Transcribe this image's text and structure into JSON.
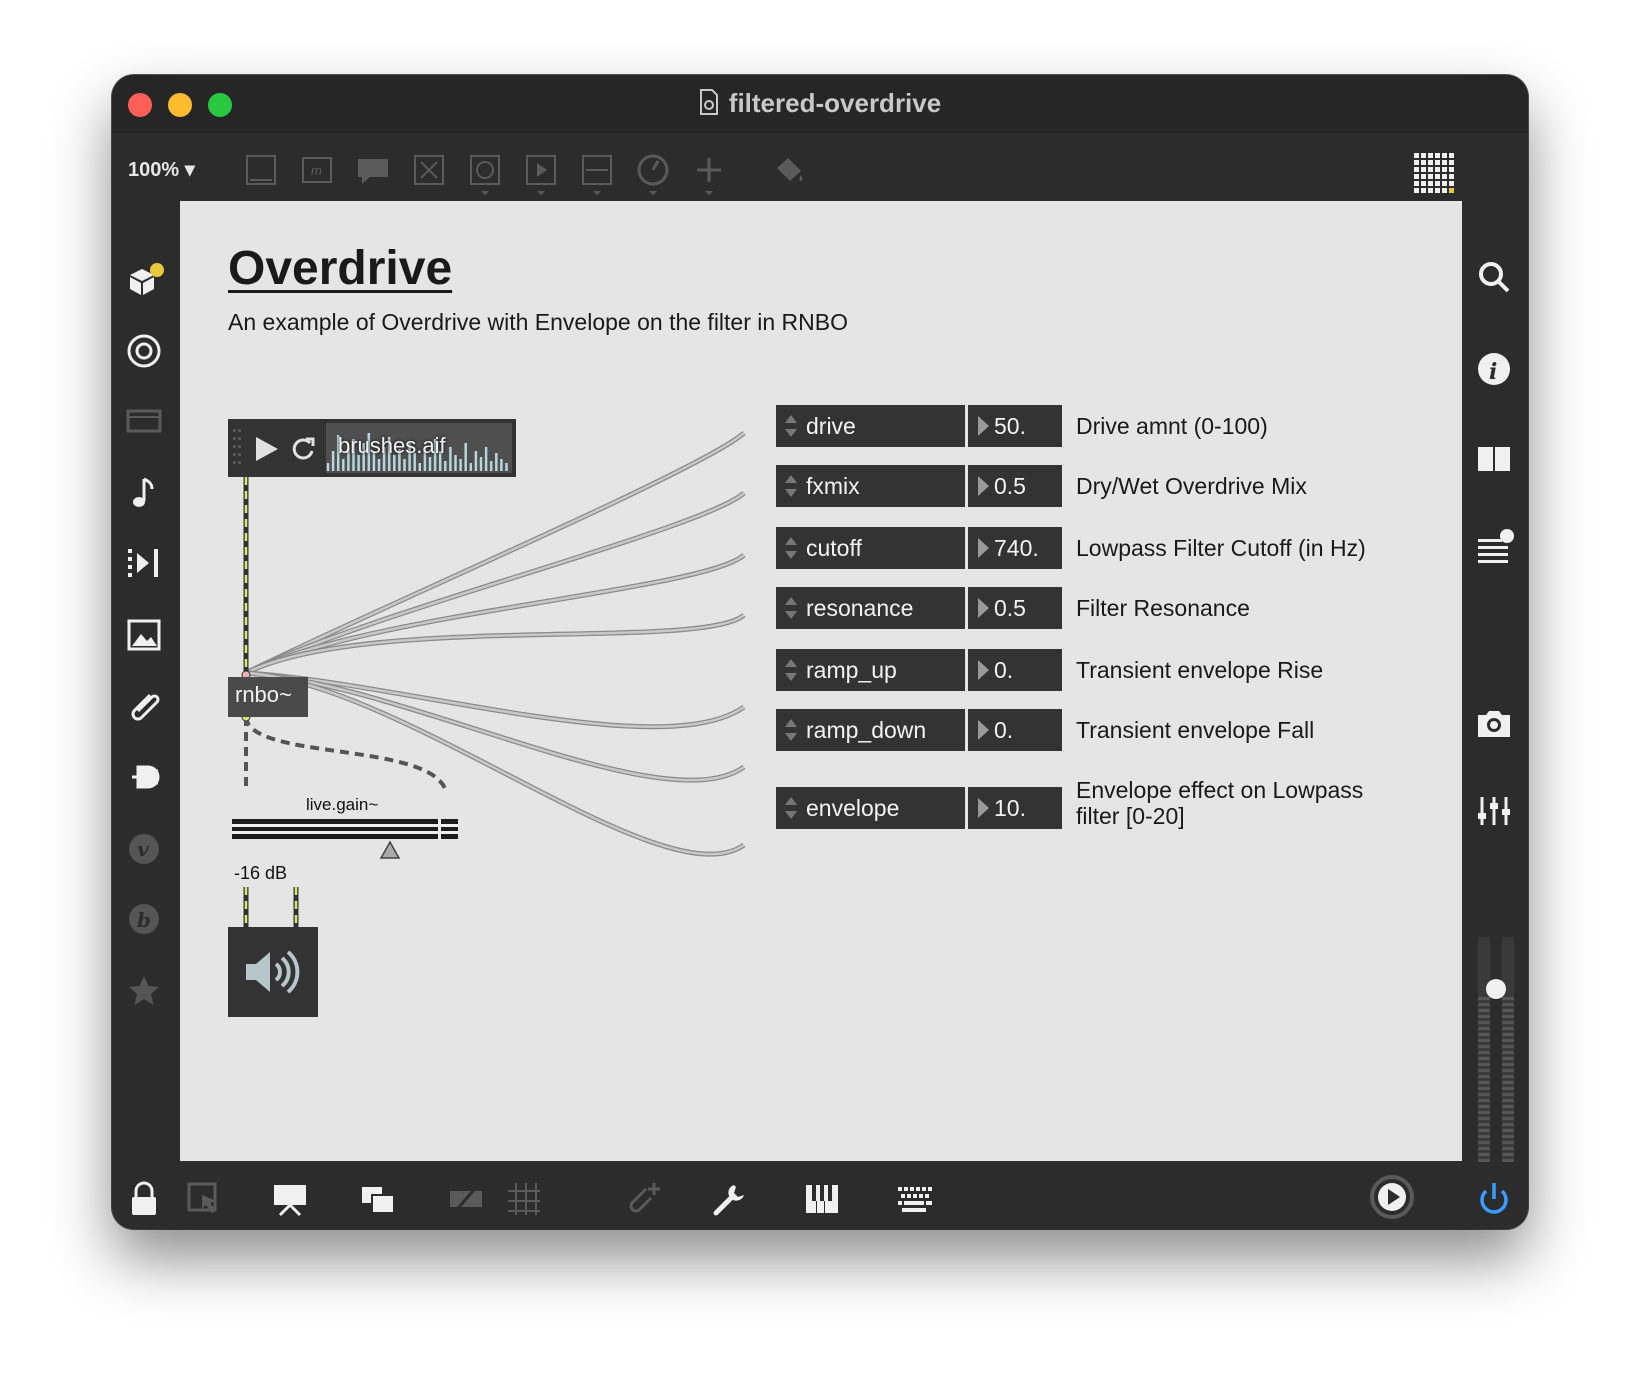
{
  "window": {
    "title": "filtered-overdrive",
    "zoom": "100%",
    "zoom_caret": "▾"
  },
  "toolbar_icons": [
    "new-object-icon",
    "message-icon",
    "comment-icon",
    "toggle-icon",
    "button-icon",
    "play-icon",
    "slider-icon",
    "dial-icon",
    "plus-icon",
    "paint-bucket-icon",
    "grid-palette-icon"
  ],
  "left_sidebar": [
    "packages-icon",
    "target-icon",
    "video-icon",
    "music-note-icon",
    "step-icon",
    "image-icon",
    "paperclip-icon",
    "plug-icon",
    "v-icon",
    "b-icon",
    "star-icon"
  ],
  "right_sidebar": [
    "search-icon",
    "info-icon",
    "split-view-icon",
    "list-icon",
    "camera-icon",
    "mixer-icon"
  ],
  "bottom_bar": [
    "lock-icon",
    "select-icon",
    "presentation-icon",
    "windows-icon",
    "hide-icon",
    "grid-icon",
    "clip-add-icon",
    "wrench-icon",
    "piano-icon",
    "keyboard-icon",
    "play-circle-icon",
    "power-icon"
  ],
  "patch": {
    "heading": "Overdrive",
    "subtitle": "An example of Overdrive with Envelope on the filter in RNBO",
    "player": {
      "file": "brushes.aif"
    },
    "rnbo": "rnbo~",
    "gain": {
      "label": "live.gain~",
      "value": "-16 dB",
      "level": 0.7
    },
    "params": [
      {
        "name": "drive",
        "value": "50.",
        "desc": "Drive amnt (0-100)"
      },
      {
        "name": "fxmix",
        "value": "0.5",
        "desc": "Dry/Wet Overdrive Mix"
      },
      {
        "name": "cutoff",
        "value": "740.",
        "desc": "Lowpass Filter Cutoff (in Hz)"
      },
      {
        "name": "resonance",
        "value": "0.5",
        "desc": "Filter Resonance"
      },
      {
        "name": "ramp_up",
        "value": "0.",
        "desc": "Transient envelope Rise"
      },
      {
        "name": "ramp_down",
        "value": "0.",
        "desc": "Transient envelope Fall"
      },
      {
        "name": "envelope",
        "value": "10.",
        "desc_line1": "Envelope effect on Lowpass",
        "desc_line2": "filter [0-20]"
      }
    ]
  },
  "colors": {
    "canvas": "#e5e5e5",
    "object": "#333333",
    "cable": "#a6a6a6",
    "signal_cable": "#d4e66b",
    "power_blue": "#3b9cff"
  }
}
